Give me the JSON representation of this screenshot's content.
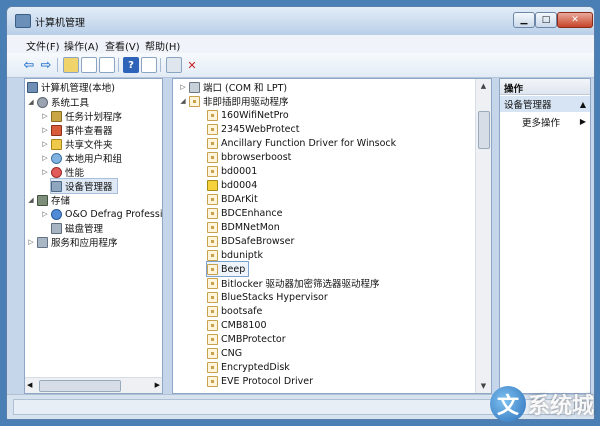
{
  "window": {
    "title": "计算机管理"
  },
  "menu": [
    "文件(F)",
    "操作(A)",
    "查看(V)",
    "帮助(H)"
  ],
  "tree": {
    "root": "计算机管理(本地)",
    "system_tools": "系统工具",
    "task_scheduler": "任务计划程序",
    "event_viewer": "事件查看器",
    "shared_folders": "共享文件夹",
    "local_users": "本地用户和组",
    "performance": "性能",
    "device_manager": "设备管理器",
    "storage": "存储",
    "defrag": "O&O Defrag Professi",
    "disk_mgmt": "磁盘管理",
    "services": "服务和应用程序"
  },
  "devices": {
    "port": "端口 (COM 和 LPT)",
    "non_pnp": "非即插即用驱动程序",
    "drivers": [
      "160WifiNetPro",
      "2345WebProtect",
      "Ancillary Function Driver for Winsock",
      "bbrowserboost",
      "bd0001",
      "bd0004",
      "BDArKit",
      "BDCEnhance",
      "BDMNetMon",
      "BDSafeBrowser",
      "bduniptk",
      "Beep",
      "Bitlocker 驱动器加密筛选器驱动程序",
      "BlueStacks Hypervisor",
      "bootsafe",
      "CMB8100",
      "CMBProtector",
      "CNG",
      "EncryptedDisk",
      "EVE Protocol Driver"
    ]
  },
  "actions": {
    "header": "操作",
    "section": "设备管理器",
    "more": "更多操作"
  },
  "watermark": {
    "logo_letter": "文",
    "text": "系统城"
  }
}
